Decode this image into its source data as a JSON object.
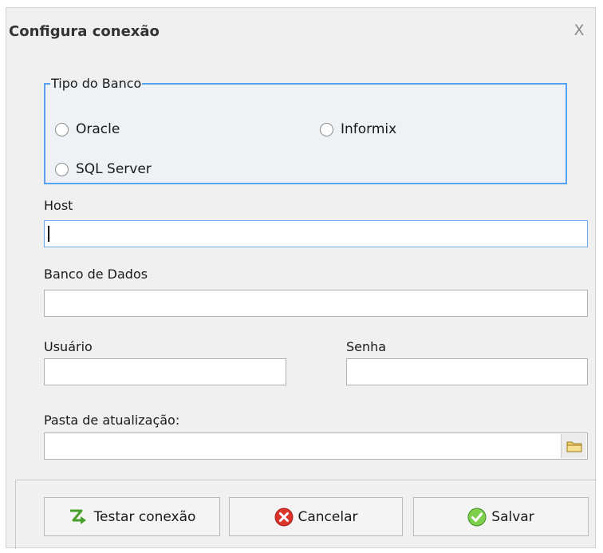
{
  "window": {
    "title": "Configura conexão",
    "close_symbol": "X"
  },
  "db_type": {
    "legend": "Tipo do Banco",
    "options": [
      {
        "label": "Oracle",
        "selected": false
      },
      {
        "label": "Informix",
        "selected": false
      },
      {
        "label": "SQL Server",
        "selected": false
      }
    ]
  },
  "fields": {
    "host": {
      "label": "Host",
      "value": ""
    },
    "database": {
      "label": "Banco de Dados",
      "value": ""
    },
    "user": {
      "label": "Usuário",
      "value": ""
    },
    "password": {
      "label": "Senha",
      "value": ""
    },
    "update_folder": {
      "label": "Pasta de atualização:",
      "value": ""
    }
  },
  "buttons": {
    "test": {
      "label": "Testar conexão",
      "icon": "lightning-arrow-icon"
    },
    "cancel": {
      "label": "Cancelar",
      "icon": "cancel-x-icon"
    },
    "save": {
      "label": "Salvar",
      "icon": "check-icon"
    }
  },
  "colors": {
    "accent": "#57a3f3",
    "cancel": "#d9332b",
    "save": "#5bb531",
    "test": "#4aa02c"
  }
}
